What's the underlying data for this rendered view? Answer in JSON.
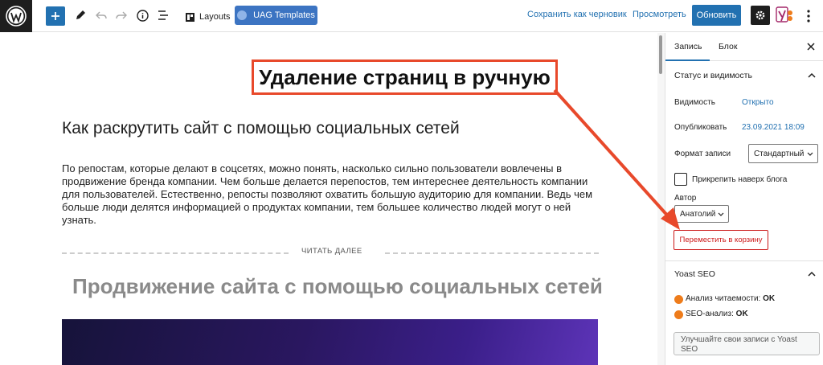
{
  "toolbar": {
    "layouts_label": "Layouts",
    "uag_label": "UAG Templates",
    "save_draft_label": "Сохранить как черновик",
    "preview_label": "Просмотреть",
    "publish_label": "Обновить",
    "icons": [
      "wordpress-logo-icon",
      "plus-icon",
      "pencil-icon",
      "undo-icon",
      "redo-icon",
      "info-icon",
      "list-view-icon",
      "layouts-icon",
      "gear-icon",
      "yoast-icon",
      "more-vertical-icon"
    ]
  },
  "annotation": {
    "text": "Удаление страниц в ручную",
    "color": "#e8492b"
  },
  "content": {
    "heading": "Как раскрутить сайт с помощью социальных сетей",
    "paragraph": "По репостам, которые делают в соцсетях, можно понять, насколько сильно пользователи вовлечены в продвижение бренда компании. Чем больше делается перепостов, тем интереснее деятельность компании для пользователей. Естественно, репосты позволяют охватить большую аудиторию для компании. Ведь чем больше люди делятся информацией о продуктах компании, тем большее количество людей могут о ней узнать.",
    "more_label": "ЧИТАТЬ ДАЛЕЕ",
    "heading2": "Продвижение сайта с помощью социальных сетей"
  },
  "sidebar": {
    "tabs": [
      "Запись",
      "Блок"
    ],
    "status_panel_title": "Статус и видимость",
    "visibility_label": "Видимость",
    "visibility_value": "Открыто",
    "publish_label": "Опубликовать",
    "publish_value": "23.09.2021 18:09",
    "format_label": "Формат записи",
    "format_value": "Стандартный",
    "sticky_label": "Прикрепить наверх блога",
    "author_label": "Автор",
    "author_value": "Анатолий",
    "trash_label": "Переместить в корзину",
    "yoast_title": "Yoast SEO",
    "readability_label": "Анализ читаемости:",
    "readability_value": "OK",
    "seo_label": "SEO-анализ:",
    "seo_value": "OK",
    "improve_label": "Улучшайте свои записи с Yoast SEO"
  },
  "colors": {
    "accent": "#2271b1",
    "danger": "#cc1818",
    "annotation": "#e8492b",
    "seo_status": "#ee7c1b"
  }
}
